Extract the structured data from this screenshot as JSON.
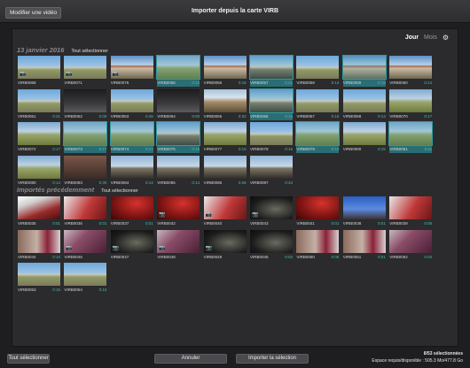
{
  "window": {
    "title": "Importer depuis la carte VIRB",
    "edit_video_button": "Modifier une vidéo"
  },
  "view_toggle": {
    "day": "Jour",
    "month": "Mois",
    "settings_icon": "gear-icon"
  },
  "sections": [
    {
      "title": "13 janvier 2016",
      "select_all": "Tout sélectionner",
      "items": [
        {
          "name": "VIRB0068",
          "dur": "",
          "sel": false,
          "photo": true,
          "style": "a"
        },
        {
          "name": "VIRB0071",
          "dur": "",
          "sel": false,
          "photo": true,
          "style": "a"
        },
        {
          "name": "VIRB0075",
          "dur": "",
          "sel": false,
          "photo": true,
          "style": "b"
        },
        {
          "name": "VIRB0055",
          "dur": "0:15",
          "sel": true,
          "photo": false,
          "style": "f"
        },
        {
          "name": "VIRB0056",
          "dur": "0:16",
          "sel": false,
          "photo": false,
          "style": "b"
        },
        {
          "name": "VIRB0057",
          "dur": "0:21",
          "sel": true,
          "photo": false,
          "style": "c"
        },
        {
          "name": "VIRB0058",
          "dur": "0:13",
          "sel": false,
          "photo": false,
          "style": "a"
        },
        {
          "name": "VIRB0059",
          "dur": "0:15",
          "sel": true,
          "photo": false,
          "style": "b"
        },
        {
          "name": "VIRB0060",
          "dur": "0:14",
          "sel": false,
          "photo": false,
          "style": "b"
        },
        {
          "name": "VIRB0061",
          "dur": "0:21",
          "sel": false,
          "photo": false,
          "style": "a"
        },
        {
          "name": "VIRB0062",
          "dur": "0:00",
          "sel": false,
          "photo": false,
          "style": "d"
        },
        {
          "name": "VIRB0063",
          "dur": "0:46",
          "sel": false,
          "photo": false,
          "style": "a"
        },
        {
          "name": "VIRB0064",
          "dur": "0:00",
          "sel": false,
          "photo": false,
          "style": "d"
        },
        {
          "name": "VIRB0065",
          "dur": "0:32",
          "sel": false,
          "photo": false,
          "style": "e"
        },
        {
          "name": "VIRB0066",
          "dur": "0:16",
          "sel": true,
          "photo": false,
          "style": "c"
        },
        {
          "name": "VIRB0067",
          "dur": "0:15",
          "sel": false,
          "photo": false,
          "style": "a"
        },
        {
          "name": "VIRB0068",
          "dur": "0:14",
          "sel": false,
          "photo": false,
          "style": "a"
        },
        {
          "name": "VIRB0070",
          "dur": "0:17",
          "sel": false,
          "photo": false,
          "style": "f"
        },
        {
          "name": "VIRB0072",
          "dur": "0:17",
          "sel": false,
          "photo": false,
          "style": "f"
        },
        {
          "name": "VIRB0073",
          "dur": "0:17",
          "sel": true,
          "photo": false,
          "style": "f"
        },
        {
          "name": "VIRB0074",
          "dur": "0:17",
          "sel": true,
          "photo": false,
          "style": "f"
        },
        {
          "name": "VIRB0075",
          "dur": "0:19",
          "sel": true,
          "photo": false,
          "style": "c"
        },
        {
          "name": "VIRB0077",
          "dur": "0:15",
          "sel": false,
          "photo": false,
          "style": "f"
        },
        {
          "name": "VIRB0078",
          "dur": "0:15",
          "sel": false,
          "photo": false,
          "style": "a"
        },
        {
          "name": "VIRB0079",
          "dur": "0:10",
          "sel": true,
          "photo": false,
          "style": "f"
        },
        {
          "name": "VIRB0080",
          "dur": "0:15",
          "sel": false,
          "photo": false,
          "style": "f"
        },
        {
          "name": "VIRB0081",
          "dur": "0:11",
          "sel": true,
          "photo": false,
          "style": "f"
        },
        {
          "name": "VIRB0080",
          "dur": "0:14",
          "sel": false,
          "photo": false,
          "style": "f"
        },
        {
          "name": "VIRB0083",
          "dur": "0:30",
          "sel": false,
          "photo": false,
          "style": "h"
        },
        {
          "name": "VIRB0084",
          "dur": "0:14",
          "sel": false,
          "photo": false,
          "style": "g"
        },
        {
          "name": "VIRB0085",
          "dur": "0:14",
          "sel": false,
          "photo": false,
          "style": "g"
        },
        {
          "name": "VIRB0086",
          "dur": "0:26",
          "sel": false,
          "photo": false,
          "style": "g"
        },
        {
          "name": "VIRB0087",
          "dur": "0:43",
          "sel": false,
          "photo": false,
          "style": "g"
        }
      ]
    },
    {
      "title": "Importés précédemment",
      "select_all": "Tout sélectionner",
      "items": [
        {
          "name": "VIRB0035",
          "dur": "0:01",
          "sel": false,
          "photo": false,
          "style": "k"
        },
        {
          "name": "VIRB0036",
          "dur": "0:01",
          "sel": false,
          "photo": false,
          "style": "w"
        },
        {
          "name": "VIRB0037",
          "dur": "0:01",
          "sel": false,
          "photo": false,
          "style": "r"
        },
        {
          "name": "VIRB0042",
          "dur": "",
          "sel": false,
          "photo": true,
          "style": "r"
        },
        {
          "name": "VIRB0040",
          "dur": "",
          "sel": false,
          "photo": true,
          "style": "w"
        },
        {
          "name": "VIRB0043",
          "dur": "",
          "sel": false,
          "photo": true,
          "style": "n"
        },
        {
          "name": "VIRB0041",
          "dur": "0:01",
          "sel": false,
          "photo": false,
          "style": "r"
        },
        {
          "name": "VIRB0038",
          "dur": "0:01",
          "sel": false,
          "photo": false,
          "style": "s"
        },
        {
          "name": "VIRB0039",
          "dur": "0:05",
          "sel": false,
          "photo": false,
          "style": "w"
        },
        {
          "name": "VIRB0044",
          "dur": "0:10",
          "sel": false,
          "photo": false,
          "style": "m"
        },
        {
          "name": "VIRB0046",
          "dur": "",
          "sel": false,
          "photo": true,
          "style": "p"
        },
        {
          "name": "VIRB0047",
          "dur": "",
          "sel": false,
          "photo": true,
          "style": "n"
        },
        {
          "name": "VIRB0048",
          "dur": "",
          "sel": false,
          "photo": true,
          "style": "p"
        },
        {
          "name": "VIRB0049",
          "dur": "",
          "sel": false,
          "photo": true,
          "style": "n"
        },
        {
          "name": "VIRB0045",
          "dur": "0:03",
          "sel": false,
          "photo": false,
          "style": "n"
        },
        {
          "name": "VIRB0050",
          "dur": "0:05",
          "sel": false,
          "photo": false,
          "style": "m"
        },
        {
          "name": "VIRB0051",
          "dur": "0:01",
          "sel": false,
          "photo": false,
          "style": "m"
        },
        {
          "name": "VIRB0052",
          "dur": "0:04",
          "sel": false,
          "photo": false,
          "style": "p"
        },
        {
          "name": "VIRB0053",
          "dur": "0:15",
          "sel": false,
          "photo": false,
          "style": "a"
        },
        {
          "name": "VIRB0054",
          "dur": "0:10",
          "sel": false,
          "photo": false,
          "style": "a"
        }
      ]
    }
  ],
  "footer": {
    "select_all": "Tout sélectionner",
    "cancel": "Annuler",
    "import": "Importer la sélection",
    "count": "8/53 sélectionnées",
    "space": "Espace requis/disponible : 505.3 Mo/477.8 Go"
  },
  "colors": {
    "selection": "#2e9aa0",
    "duration": "#43c0b0",
    "background": "#2b2b2d"
  }
}
